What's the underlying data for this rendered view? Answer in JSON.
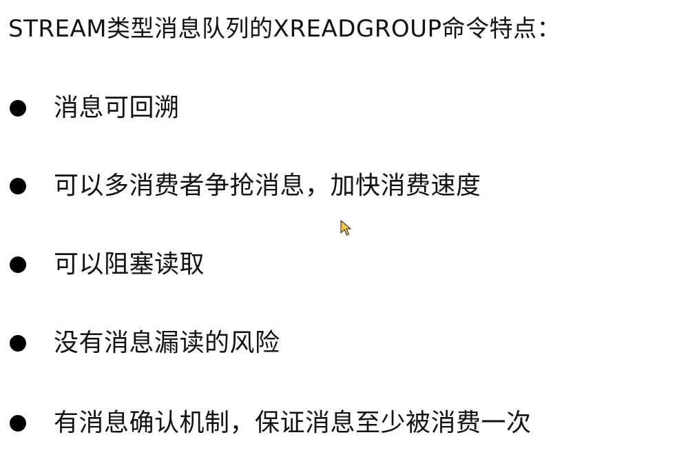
{
  "title": "STREAM类型消息队列的XREADGROUP命令特点：",
  "bullets": [
    "消息可回溯",
    "可以多消费者争抢消息，加快消费速度",
    "可以阻塞读取",
    "没有消息漏读的风险",
    "有消息确认机制，保证消息至少被消费一次"
  ],
  "cursor_icon": "mouse-pointer-icon"
}
